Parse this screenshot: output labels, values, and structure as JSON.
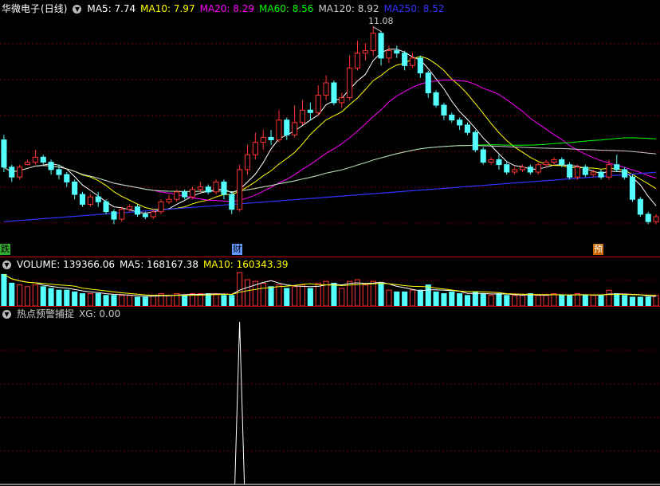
{
  "main_panel": {
    "stock_name": "华微电子",
    "period": "(日线)",
    "ma_labels": [
      {
        "text": "MA5: 7.74",
        "color": "#ffffff"
      },
      {
        "text": "MA10: 7.97",
        "color": "#ffff00"
      },
      {
        "text": "MA20: 8.29",
        "color": "#ff00ff"
      },
      {
        "text": "MA60: 8.56",
        "color": "#00ff00"
      },
      {
        "text": "MA120: 8.92",
        "color": "#cccccc"
      },
      {
        "text": "MA250: 8.52",
        "color": "#3333ff"
      }
    ],
    "high_marker": "11.08",
    "event_badges": [
      {
        "text": "跌",
        "bg": "#33aa33"
      },
      {
        "text": "财",
        "bg": "#6699ff"
      },
      {
        "text": "预",
        "bg": "#cc6600"
      }
    ]
  },
  "volume_panel": {
    "label": "VOLUME: 139366.06",
    "ma5": "MA5: 168167.38",
    "ma10": "MA10: 160343.39"
  },
  "indicator_panel": {
    "name": "热点预警捕捉",
    "value": "XG: 0.00"
  },
  "colors": {
    "up": "#ff3232",
    "down": "#54ffff",
    "grid": "#7a0000",
    "separator": "#c00000"
  },
  "chart_data": {
    "type": "candlestick",
    "ylim": [
      6.8,
      11.3
    ],
    "candles": [
      [
        8.8,
        8.25,
        8.9,
        8.15
      ],
      [
        8.25,
        8.05,
        8.3,
        7.95
      ],
      [
        8.05,
        8.25,
        8.3,
        8.0
      ],
      [
        8.3,
        8.35,
        8.4,
        8.3
      ],
      [
        8.35,
        8.45,
        8.6,
        8.3
      ],
      [
        8.45,
        8.35,
        8.5,
        8.3
      ],
      [
        8.35,
        8.2,
        8.4,
        8.1
      ],
      [
        8.2,
        8.1,
        8.3,
        8.0
      ],
      [
        8.1,
        7.95,
        8.15,
        7.85
      ],
      [
        7.95,
        7.7,
        8.0,
        7.6
      ],
      [
        7.7,
        7.5,
        7.75,
        7.45
      ],
      [
        7.5,
        7.65,
        7.7,
        7.45
      ],
      [
        7.65,
        7.55,
        7.75,
        7.45
      ],
      [
        7.55,
        7.35,
        7.6,
        7.3
      ],
      [
        7.35,
        7.2,
        7.4,
        7.1
      ],
      [
        7.2,
        7.4,
        7.45,
        7.15
      ],
      [
        7.4,
        7.45,
        7.5,
        7.35
      ],
      [
        7.45,
        7.3,
        7.5,
        7.25
      ],
      [
        7.3,
        7.25,
        7.35,
        7.2
      ],
      [
        7.25,
        7.35,
        7.4,
        7.2
      ],
      [
        7.35,
        7.55,
        7.6,
        7.3
      ],
      [
        7.55,
        7.6,
        7.7,
        7.5
      ],
      [
        7.6,
        7.75,
        7.8,
        7.55
      ],
      [
        7.75,
        7.65,
        7.8,
        7.6
      ],
      [
        7.65,
        7.8,
        7.85,
        7.6
      ],
      [
        7.8,
        7.85,
        7.95,
        7.75
      ],
      [
        7.85,
        7.75,
        7.9,
        7.7
      ],
      [
        7.75,
        7.95,
        8.0,
        7.7
      ],
      [
        7.95,
        7.7,
        8.0,
        7.6
      ],
      [
        7.7,
        7.4,
        7.75,
        7.3
      ],
      [
        7.4,
        8.2,
        8.3,
        7.35
      ],
      [
        8.2,
        8.5,
        8.7,
        8.1
      ],
      [
        8.5,
        8.75,
        8.95,
        8.4
      ],
      [
        8.75,
        8.85,
        9.0,
        8.6
      ],
      [
        8.85,
        8.8,
        9.0,
        8.7
      ],
      [
        8.8,
        9.2,
        9.4,
        8.75
      ],
      [
        9.2,
        8.9,
        9.25,
        8.8
      ],
      [
        8.9,
        9.15,
        9.5,
        8.85
      ],
      [
        9.15,
        9.4,
        9.6,
        9.1
      ],
      [
        9.4,
        9.35,
        9.55,
        9.2
      ],
      [
        9.35,
        9.7,
        9.9,
        9.3
      ],
      [
        9.7,
        9.95,
        10.1,
        9.6
      ],
      [
        9.95,
        9.55,
        10.0,
        9.5
      ],
      [
        9.55,
        9.65,
        9.75,
        9.45
      ],
      [
        9.65,
        10.25,
        10.5,
        9.6
      ],
      [
        10.25,
        10.55,
        10.8,
        10.2
      ],
      [
        10.55,
        10.6,
        10.75,
        10.4
      ],
      [
        10.6,
        10.95,
        11.08,
        10.5
      ],
      [
        10.95,
        10.45,
        11.0,
        10.3
      ],
      [
        10.45,
        10.6,
        10.7,
        10.35
      ],
      [
        10.6,
        10.55,
        10.7,
        10.45
      ],
      [
        10.55,
        10.3,
        10.6,
        10.2
      ],
      [
        10.3,
        10.45,
        10.55,
        10.25
      ],
      [
        10.45,
        10.15,
        10.5,
        10.05
      ],
      [
        10.15,
        9.75,
        10.2,
        9.65
      ],
      [
        9.75,
        9.5,
        9.8,
        9.45
      ],
      [
        9.5,
        9.3,
        9.55,
        9.2
      ],
      [
        9.3,
        9.2,
        9.35,
        9.15
      ],
      [
        9.2,
        9.1,
        9.25,
        9.0
      ],
      [
        9.1,
        8.95,
        9.15,
        8.9
      ],
      [
        8.95,
        8.6,
        9.0,
        8.55
      ],
      [
        8.6,
        8.35,
        8.65,
        8.3
      ],
      [
        8.35,
        8.4,
        8.45,
        8.3
      ],
      [
        8.4,
        8.3,
        8.5,
        8.2
      ],
      [
        8.3,
        8.15,
        8.35,
        8.1
      ],
      [
        8.15,
        8.2,
        8.25,
        8.1
      ],
      [
        8.2,
        8.25,
        8.3,
        8.15
      ],
      [
        8.25,
        8.15,
        8.3,
        8.1
      ],
      [
        8.15,
        8.3,
        8.35,
        8.1
      ],
      [
        8.3,
        8.35,
        8.4,
        8.25
      ],
      [
        8.35,
        8.4,
        8.45,
        8.3
      ],
      [
        8.4,
        8.3,
        8.45,
        8.25
      ],
      [
        8.3,
        8.05,
        8.35,
        8.0
      ],
      [
        8.05,
        8.25,
        8.3,
        8.0
      ],
      [
        8.25,
        8.1,
        8.3,
        8.05
      ],
      [
        8.1,
        8.15,
        8.2,
        8.05
      ],
      [
        8.15,
        8.05,
        8.2,
        8.0
      ],
      [
        8.05,
        8.3,
        8.4,
        8.0
      ],
      [
        8.3,
        8.2,
        8.5,
        8.15
      ],
      [
        8.2,
        8.05,
        8.25,
        8.0
      ],
      [
        8.05,
        7.6,
        8.1,
        7.55
      ],
      [
        7.6,
        7.3,
        7.65,
        7.25
      ],
      [
        7.3,
        7.15,
        7.35,
        7.1
      ],
      [
        7.15,
        7.25,
        7.3,
        7.1
      ]
    ],
    "volumes": [
      36,
      26,
      24,
      22,
      24,
      22,
      20,
      18,
      18,
      16,
      14,
      14,
      14,
      12,
      12,
      12,
      12,
      10,
      10,
      12,
      14,
      12,
      14,
      12,
      14,
      14,
      14,
      14,
      12,
      12,
      38,
      30,
      28,
      26,
      22,
      24,
      20,
      22,
      24,
      20,
      26,
      28,
      26,
      20,
      28,
      30,
      24,
      28,
      26,
      18,
      16,
      16,
      18,
      18,
      24,
      16,
      14,
      16,
      14,
      12,
      16,
      14,
      12,
      14,
      12,
      12,
      12,
      14,
      12,
      12,
      14,
      12,
      12,
      14,
      12,
      12,
      12,
      18,
      14,
      12,
      10,
      10,
      10,
      12
    ],
    "indicator_spike_index": 30
  }
}
